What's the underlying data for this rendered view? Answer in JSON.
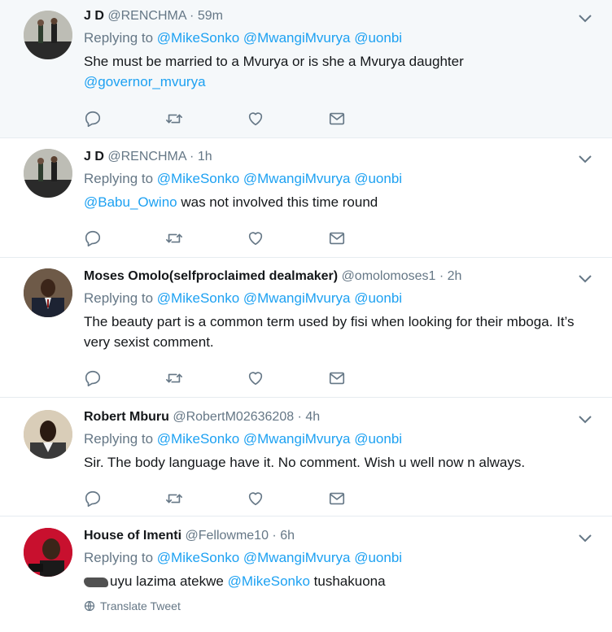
{
  "tweets": [
    {
      "name": "J D",
      "handle": "@RENCHMA",
      "time": "59m",
      "reply_prefix": "Replying to",
      "reply_to": [
        "@MikeSonko",
        "@MwangiMvurya",
        "@uonbi"
      ],
      "text_before": "She must be married to a Mvurya or is she a Mvurya daughter",
      "mention_after": "@governor_mvurya"
    },
    {
      "name": "J D",
      "handle": "@RENCHMA",
      "time": "1h",
      "reply_prefix": "Replying to",
      "reply_to": [
        "@MikeSonko",
        "@MwangiMvurya",
        "@uonbi"
      ],
      "mention_before": "@Babu_Owino",
      "text_after": " was not involved this time round"
    },
    {
      "name": "Moses Omolo(selfproclaimed dealmaker)",
      "handle": "@omolomoses1",
      "time": "2h",
      "reply_prefix": "Replying to",
      "reply_to": [
        "@MikeSonko",
        "@MwangiMvurya",
        "@uonbi"
      ],
      "text": "The beauty part is a common term used by fisi when looking for their mboga. It’s very sexist comment."
    },
    {
      "name": "Robert Mburu",
      "handle": "@RobertM02636208",
      "time": "4h",
      "reply_prefix": "Replying to",
      "reply_to": [
        "@MikeSonko",
        "@MwangiMvurya",
        "@uonbi"
      ],
      "text": "Sir. The body language have it. No comment. Wish u well now n always."
    },
    {
      "name": "House of Imenti",
      "handle": "@Fellowme10",
      "time": "6h",
      "reply_prefix": "Replying to",
      "reply_to": [
        "@MikeSonko",
        "@MwangiMvurya",
        "@uonbi"
      ],
      "text_before": "uyu lazima atekwe ",
      "mention": "@MikeSonko",
      "text_after": " tushakuona",
      "translate": "Translate Tweet"
    }
  ],
  "separator": " · ",
  "icons": [
    "chevron-down-icon",
    "reply-icon",
    "retweet-icon",
    "like-icon",
    "message-icon",
    "globe-icon"
  ],
  "colors": {
    "link": "#1da1f2",
    "muted": "#657786",
    "highlight_bg": "#f5f8fa"
  }
}
